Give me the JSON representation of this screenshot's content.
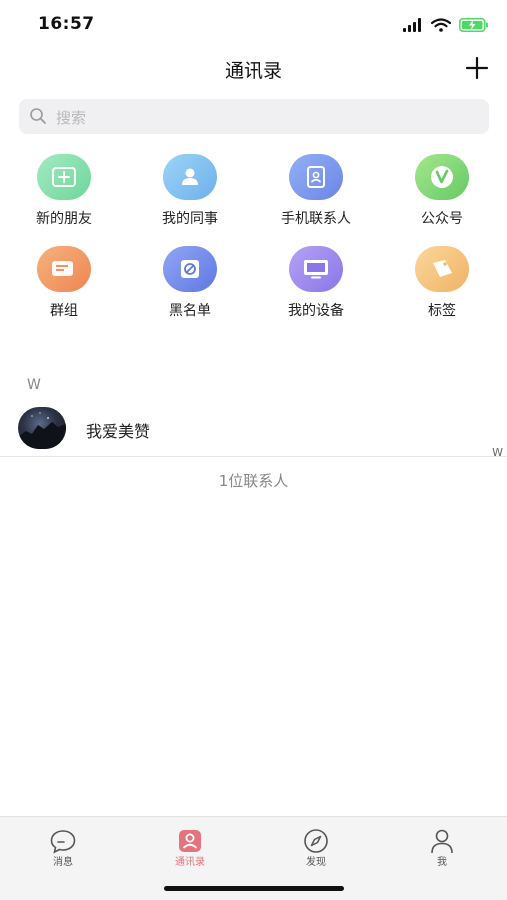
{
  "status_bar": {
    "time": "16:57"
  },
  "header": {
    "title": "通讯录"
  },
  "search": {
    "placeholder": "搜索"
  },
  "grid": [
    {
      "label": "新的朋友",
      "icon": "add-friend-icon"
    },
    {
      "label": "我的同事",
      "icon": "colleague-icon"
    },
    {
      "label": "手机联系人",
      "icon": "phone-contacts-icon"
    },
    {
      "label": "公众号",
      "icon": "official-account-icon"
    },
    {
      "label": "群组",
      "icon": "group-chat-icon"
    },
    {
      "label": "黑名单",
      "icon": "blacklist-icon"
    },
    {
      "label": "我的设备",
      "icon": "device-icon"
    },
    {
      "label": "标签",
      "icon": "tag-icon"
    }
  ],
  "contacts": {
    "section_letter": "W",
    "items": [
      {
        "name": "我爱美赞"
      }
    ],
    "index_letter": "W",
    "count_text": "1位联系人"
  },
  "tabs": [
    {
      "label": "消息",
      "icon": "message-icon"
    },
    {
      "label": "通讯录",
      "icon": "contacts-icon",
      "active": true
    },
    {
      "label": "发现",
      "icon": "discover-icon"
    },
    {
      "label": "我",
      "icon": "profile-icon"
    }
  ],
  "colors": {
    "active_tab": "#e4737e",
    "search_bg": "#f0f0f2"
  }
}
